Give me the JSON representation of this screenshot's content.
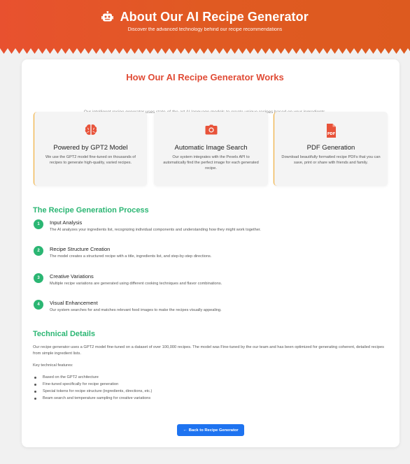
{
  "header": {
    "title": "About Our AI Recipe Generator",
    "subtitle": "Discover the advanced technology behind our recipe recommendations",
    "icon": "robot-icon",
    "gradient": [
      "#e8512f",
      "#dd5a1f"
    ]
  },
  "main": {
    "title": "How Our AI Recipe Generator Works",
    "intro": "Our intelligent recipe generator uses state-of-the-art AI language models to create unique recipes based on your ingredients."
  },
  "features": [
    {
      "icon": "brain-icon",
      "title": "Powered by GPT2 Model",
      "description": "We use the GPT2 model fine-tuned on thousands of recipes to generate high-quality, varied recipes."
    },
    {
      "icon": "camera-icon",
      "title": "Automatic Image Search",
      "description": "Our system integrates with the Pexels API to automatically find the perfect image for each generated recipe."
    },
    {
      "icon": "pdf-file-icon",
      "title": "PDF Generation",
      "description": "Download beautifully formatted recipe PDFs that you can save, print or share with friends and family."
    }
  ],
  "process": {
    "title": "The Recipe Generation Process",
    "steps": [
      {
        "number": "1",
        "title": "Input Analysis",
        "description": "The AI analyzes your ingredients list, recognizing individual components and understanding how they might work together."
      },
      {
        "number": "2",
        "title": "Recipe Structure Creation",
        "description": "The model creates a structured recipe with a title, ingredients list, and step-by-step directions."
      },
      {
        "number": "3",
        "title": "Creative Variations",
        "description": "Multiple recipe variations are generated using different cooking techniques and flavor combinations."
      },
      {
        "number": "4",
        "title": "Visual Enhancement",
        "description": "Our system searches for and matches relevant food images to make the recipes visually appealing."
      }
    ]
  },
  "technical": {
    "title": "Technical Details",
    "paragraph": "Our recipe generator uses a GPT2 model fine-tuned on a dataset of over 100,000 recipes. The model was Fine-tuned by the our team and has been optimized for generating coherent, detailed recipes from simple ingredient lists.",
    "key_label": "Key technical features:",
    "features": [
      "Based on the GPT2 architecture",
      "Fine-tuned specifically for recipe generation",
      "Special tokens for recipe structure (ingredients, directions, etc.)",
      "Beam search and temperature sampling for creative variations"
    ]
  },
  "back_button": {
    "icon": "arrow-left-icon",
    "label": "Back to Recipe Generator"
  },
  "colors": {
    "accent_red": "#e04b35",
    "accent_green": "#2bb673",
    "accent_orange": "#f2a623",
    "button_blue": "#1e73f0"
  }
}
